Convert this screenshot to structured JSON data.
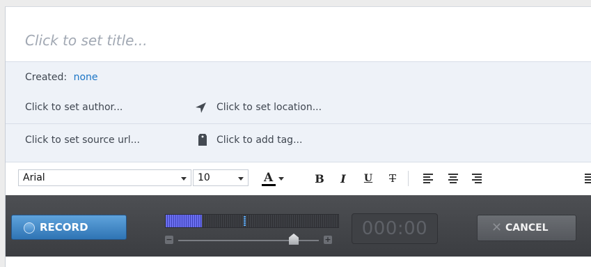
{
  "note": {
    "title_placeholder": "Click to set title...",
    "created_label": "Created:",
    "created_value": "none",
    "author_placeholder": "Click to set author...",
    "location_placeholder": "Click to set location...",
    "source_url_placeholder": "Click to set source url...",
    "tag_placeholder": "Click to add tag..."
  },
  "toolbar": {
    "font_family": "Arial",
    "font_size": "10",
    "font_color_letter": "A",
    "bold_label": "B",
    "italic_label": "I",
    "underline_label": "U",
    "strikethrough_label": "T"
  },
  "recorder": {
    "record_label": "RECORD",
    "timer": "000:00",
    "cancel_label": "CANCEL",
    "input_level": 0.21,
    "peak_level": 0.45,
    "volume": 0.82
  },
  "icons": {
    "location": "location-arrow-icon",
    "tag": "tag-icon",
    "font_color": "font-color-icon",
    "align_left": "align-left-icon",
    "align_center": "align-center-icon",
    "align_right": "align-right-icon",
    "align_justify": "align-justify-icon"
  },
  "colors": {
    "accent": "#1b75c6",
    "record_button": "#3f86c7",
    "recorder_bar": "#444649",
    "meter_level": "#6b6ff0",
    "font_color_underline": "#000000"
  }
}
